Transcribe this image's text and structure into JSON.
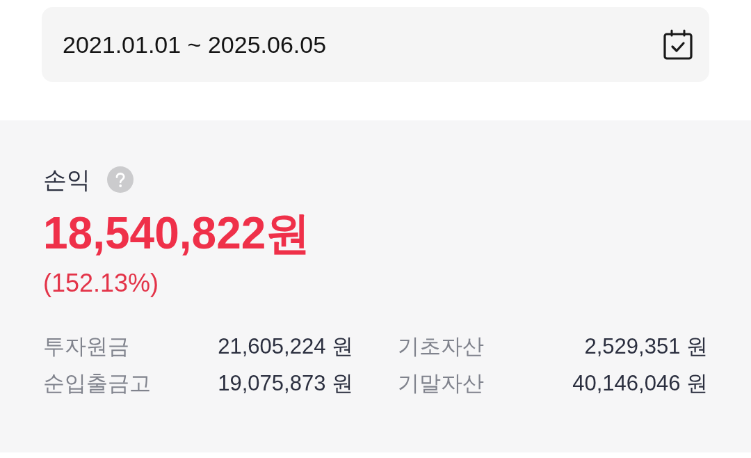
{
  "date_range": {
    "value": "2021.01.01 ~ 2025.06.05"
  },
  "profit": {
    "label": "손익",
    "amount": "18,540,822원",
    "rate": "(152.13%)"
  },
  "stats": [
    {
      "label": "투자원금",
      "value": "21,605,224 원"
    },
    {
      "label": "기초자산",
      "value": "2,529,351 원"
    },
    {
      "label": "순입출금고",
      "value": "19,075,873 원"
    },
    {
      "label": "기말자산",
      "value": "40,146,046 원"
    }
  ]
}
